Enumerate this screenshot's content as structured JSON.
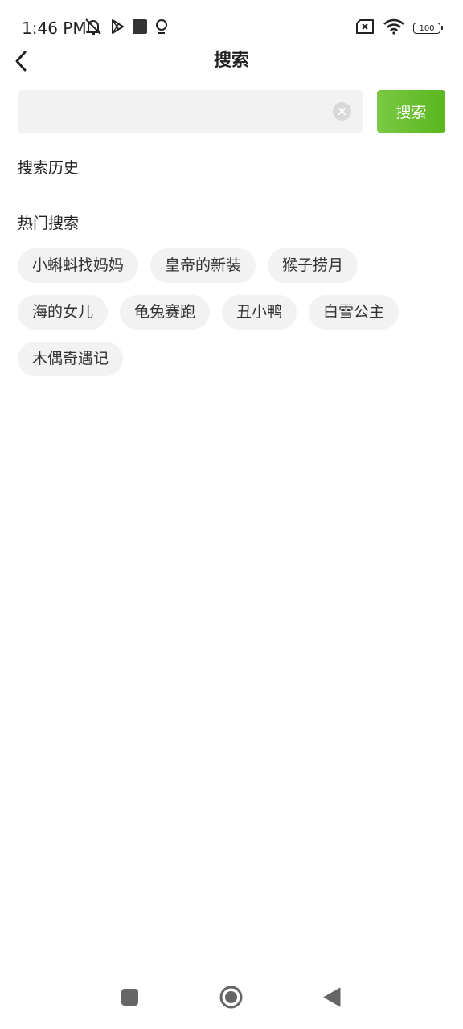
{
  "status_bar": {
    "time": "1:46 PM",
    "battery_level": "100",
    "icons": [
      "muted-bell-icon",
      "play-store-icon",
      "stop-square-icon",
      "location-pin-icon",
      "no-sim-icon",
      "wifi-icon",
      "battery-icon"
    ]
  },
  "app_bar": {
    "title": "搜索",
    "back_icon": "chevron-left-icon"
  },
  "search": {
    "value": "",
    "placeholder": "",
    "clear_icon": "clear-circle-icon",
    "button_label": "搜索"
  },
  "history": {
    "title": "搜索历史"
  },
  "hot": {
    "title": "热门搜索",
    "tags": [
      "小蝌蚪找妈妈",
      "皇帝的新装",
      "猴子捞月",
      "海的女儿",
      "龟兔赛跑",
      "丑小鸭",
      "白雪公主",
      "木偶奇遇记"
    ]
  },
  "colors": {
    "accent": "#5ab61e",
    "tag_bg": "#f2f2f2",
    "input_bg": "#f2f2f2"
  },
  "nav_bar": {
    "icons": [
      "recent-apps-icon",
      "home-icon",
      "back-icon"
    ]
  }
}
